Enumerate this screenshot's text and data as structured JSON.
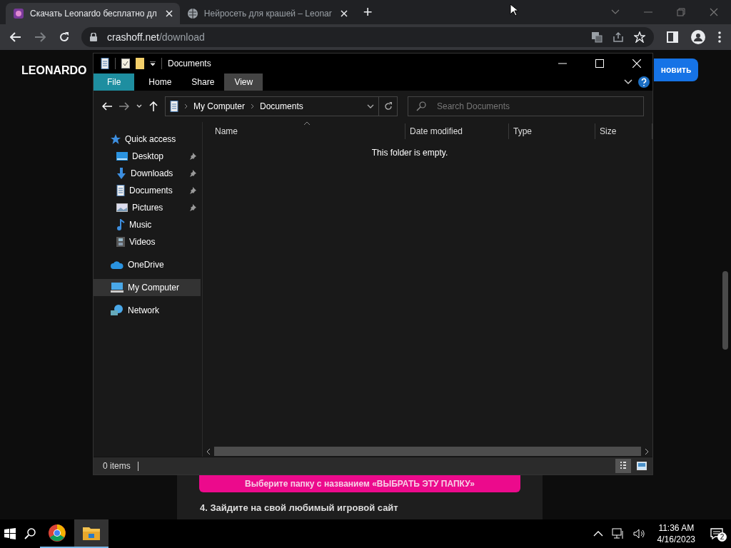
{
  "browser": {
    "tabs": [
      {
        "title": "Скачать Leonardo бесплатно дл",
        "selected": true,
        "kind": "logo"
      },
      {
        "title": "Нейросеть для крашей – Leonar",
        "selected": false,
        "kind": "globe"
      }
    ],
    "new_tab": "+",
    "address": {
      "domain": "crashoff.net",
      "path": "/download"
    }
  },
  "page": {
    "logo": "LEONARDO",
    "install_button": "новить",
    "folder_button": "Выберите папку с названием «ВЫБРАТЬ ЭТУ ПАПКУ»",
    "step_heading": "4. Зайдите на свой любимый игровой сайт"
  },
  "explorer": {
    "title": "Documents",
    "ribbon_tabs": [
      {
        "label": "File",
        "selected": false,
        "kind": "backstage"
      },
      {
        "label": "Home",
        "selected": false,
        "kind": "tab"
      },
      {
        "label": "Share",
        "selected": false,
        "kind": "tab"
      },
      {
        "label": "View",
        "selected": true,
        "kind": "tab"
      }
    ],
    "breadcrumbs": [
      "My Computer",
      "Documents"
    ],
    "search": {
      "placeholder": "Search Documents"
    },
    "columns": [
      {
        "label": "Name",
        "sorted": true
      },
      {
        "label": "Date modified",
        "sorted": false
      },
      {
        "label": "Type",
        "sorted": false
      },
      {
        "label": "Size",
        "sorted": false
      }
    ],
    "empty_message": "This folder is empty.",
    "sidebar": [
      {
        "label": "Quick access",
        "kind": "star",
        "selected": false,
        "children": [
          {
            "label": "Desktop",
            "kind": "desktop",
            "pinned": true,
            "selected": false
          },
          {
            "label": "Downloads",
            "kind": "download",
            "pinned": true,
            "selected": false
          },
          {
            "label": "Documents",
            "kind": "document",
            "pinned": true,
            "selected": false
          },
          {
            "label": "Pictures",
            "kind": "pictures",
            "pinned": true,
            "selected": false
          },
          {
            "label": "Music",
            "kind": "music",
            "pinned": false,
            "selected": false
          },
          {
            "label": "Videos",
            "kind": "videos",
            "pinned": false,
            "selected": false
          }
        ]
      },
      {
        "label": "OneDrive",
        "kind": "cloud",
        "selected": false
      },
      {
        "label": "My Computer",
        "kind": "computer",
        "selected": true
      },
      {
        "label": "Network",
        "kind": "network",
        "selected": false
      }
    ],
    "status": "0 items",
    "view_buttons": [
      {
        "kind": "details",
        "selected": true
      },
      {
        "kind": "large",
        "selected": false
      }
    ]
  },
  "taskbar": {
    "apps": [
      {
        "kind": "browser",
        "selected": false
      },
      {
        "kind": "folder",
        "selected": true
      }
    ],
    "time": "11:36 AM",
    "date": "4/16/2023",
    "notifications": "2"
  }
}
